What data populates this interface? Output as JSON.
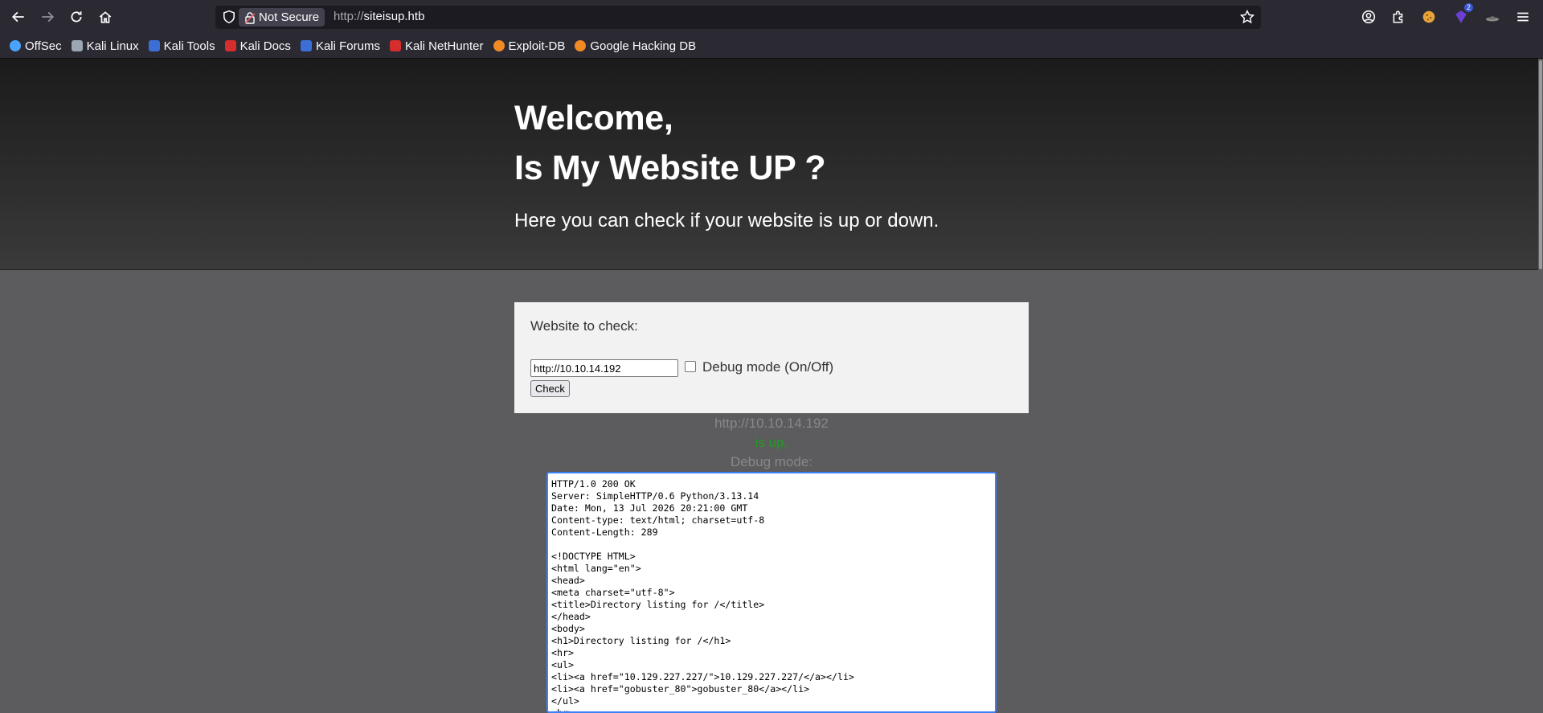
{
  "browser": {
    "security_label": "Not Secure",
    "url_protocol": "http://",
    "url_host": "siteisup.htb",
    "extension_badge": "2",
    "bookmarks": [
      {
        "label": "OffSec",
        "color": "#4aa3ff"
      },
      {
        "label": "Kali Linux",
        "color": "#9aa6b2"
      },
      {
        "label": "Kali Tools",
        "color": "#3b6fd6"
      },
      {
        "label": "Kali Docs",
        "color": "#d62d2d"
      },
      {
        "label": "Kali Forums",
        "color": "#3b6fd6"
      },
      {
        "label": "Kali NetHunter",
        "color": "#d62d2d"
      },
      {
        "label": "Exploit-DB",
        "color": "#f08a24"
      },
      {
        "label": "Google Hacking DB",
        "color": "#f08a24"
      }
    ]
  },
  "hero": {
    "line1": "Welcome,",
    "line2": "Is My Website UP ?",
    "subtitle": "Here you can check if your website is up or down."
  },
  "form": {
    "label": "Website to check:",
    "url_value": "http://10.10.14.192",
    "debug_label": "Debug mode (On/Off)",
    "debug_checked": false,
    "check_button": "Check"
  },
  "result": {
    "url": "http://10.10.14.192",
    "status": "is up.",
    "debug_heading": "Debug mode:",
    "debug_output": "HTTP/1.0 200 OK\nServer: SimpleHTTP/0.6 Python/3.13.14\nDate: Mon, 13 Jul 2026 20:21:00 GMT\nContent-type: text/html; charset=utf-8\nContent-Length: 289\n\n<!DOCTYPE HTML>\n<html lang=\"en\">\n<head>\n<meta charset=\"utf-8\">\n<title>Directory listing for /</title>\n</head>\n<body>\n<h1>Directory listing for /</h1>\n<hr>\n<ul>\n<li><a href=\"10.129.227.227/\">10.129.227.227/</a></li>\n<li><a href=\"gobuster_80\">gobuster_80</a></li>\n</ul>\n<hr>"
  },
  "colors": {
    "status_up": "#1f9e1f",
    "chrome_bg": "#2b2a33",
    "page_bg": "#5c5b5e"
  }
}
